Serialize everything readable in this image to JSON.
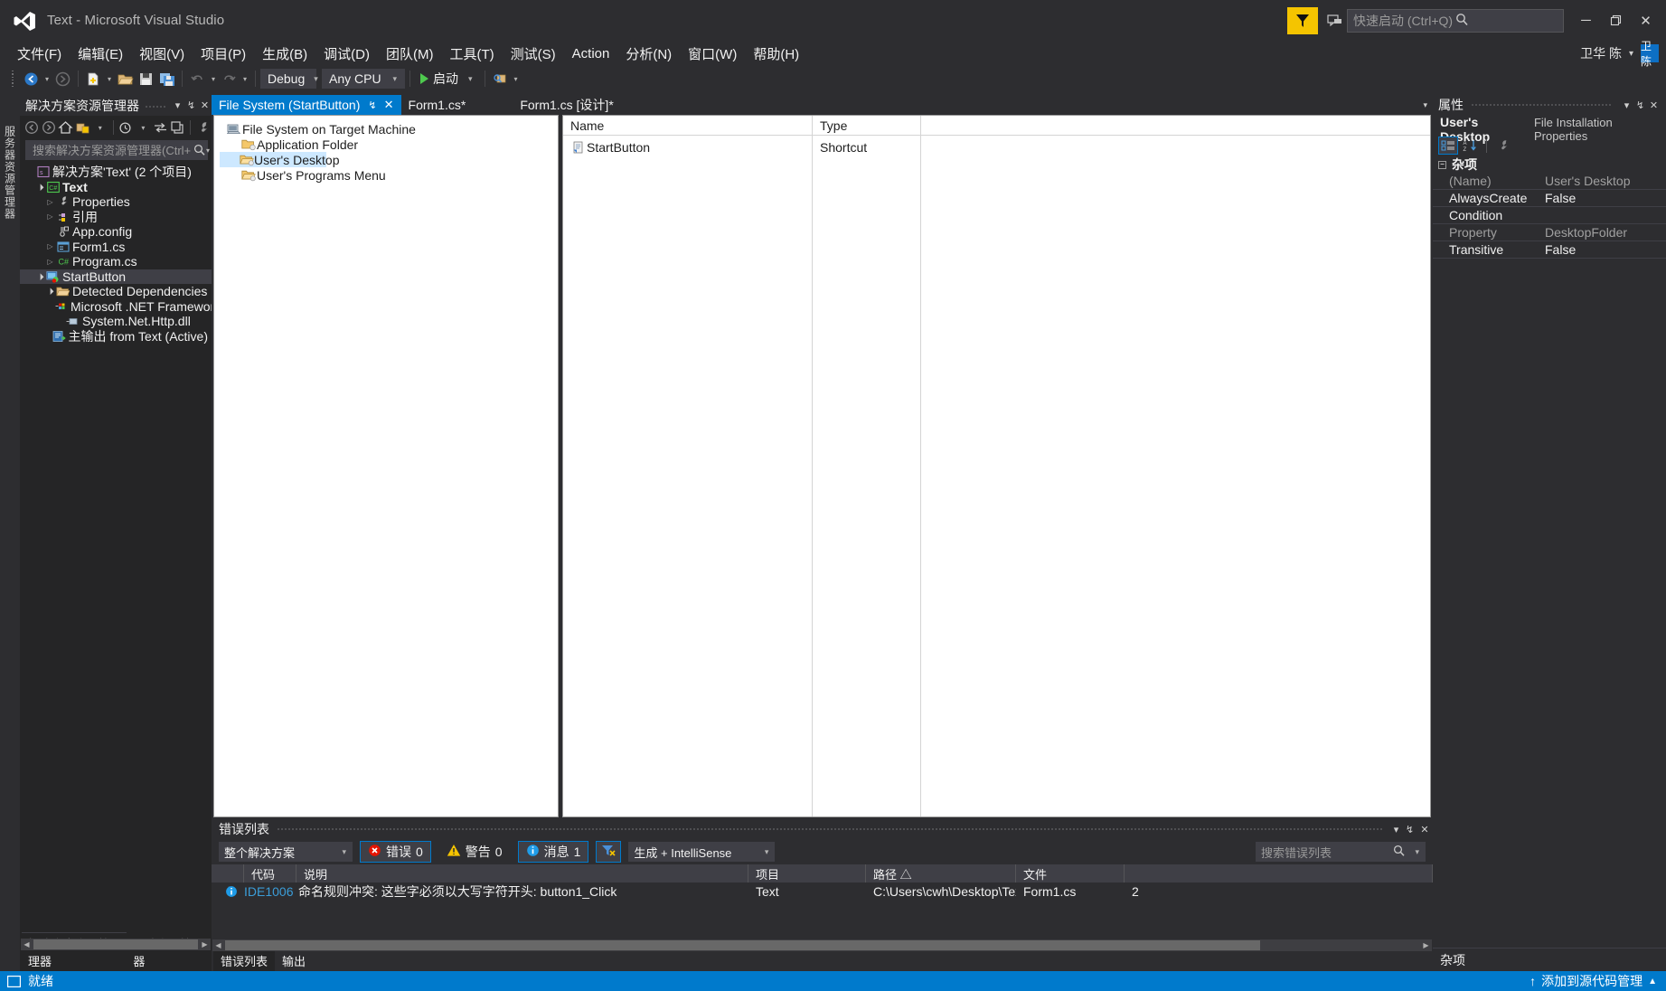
{
  "window": {
    "title": "Text - Microsoft Visual Studio",
    "logo_icon": "visual-studio-logo",
    "minimize_label": "─",
    "restore_label": "❐",
    "close_label": "✕"
  },
  "quick_launch": {
    "placeholder": "快速启动 (Ctrl+Q)",
    "value": "",
    "icon": "search-icon"
  },
  "feedback": {
    "icon": "feedback-filter-icon"
  },
  "speech": {
    "icon": "speech-bubble-icon"
  },
  "account": {
    "name": "卫华 陈",
    "badge": "卫陈",
    "caret": "▾"
  },
  "menu": {
    "items": [
      {
        "label": "文件(F)"
      },
      {
        "label": "编辑(E)"
      },
      {
        "label": "视图(V)"
      },
      {
        "label": "项目(P)"
      },
      {
        "label": "生成(B)"
      },
      {
        "label": "调试(D)"
      },
      {
        "label": "团队(M)"
      },
      {
        "label": "工具(T)"
      },
      {
        "label": "测试(S)"
      },
      {
        "label": "Action"
      },
      {
        "label": "分析(N)"
      },
      {
        "label": "窗口(W)"
      },
      {
        "label": "帮助(H)"
      }
    ]
  },
  "toolbar": {
    "back_icon": "navigate-back-icon",
    "forward_icon": "navigate-forward-icon",
    "new_item_icon": "new-item-icon",
    "open_icon": "open-file-icon",
    "save_icon": "save-icon",
    "save_all_icon": "save-all-icon",
    "undo_icon": "undo-icon",
    "redo_icon": "redo-icon",
    "config": {
      "value": "Debug",
      "caret": "▾"
    },
    "platform": {
      "value": "Any CPU",
      "caret": "▾"
    },
    "run": {
      "label": "启动",
      "caret": "▾",
      "icon": "play-icon"
    },
    "more_icon": "toolbar-overflow-icon"
  },
  "left_strip": {
    "tabs": [
      {
        "label": "服务器资源管理器"
      }
    ]
  },
  "solution_explorer": {
    "title": "解决方案资源管理器",
    "header_buttons": {
      "dropdown": "▾",
      "pin": "↯",
      "close": "✕"
    },
    "tools": [
      {
        "icon": "back-icon"
      },
      {
        "icon": "forward-icon"
      },
      {
        "icon": "home-icon"
      },
      {
        "icon": "sync-views-icon"
      },
      {
        "icon": "pending-changes-icon"
      },
      {
        "icon": "refresh-icon"
      },
      {
        "icon": "collapse-all-icon"
      },
      {
        "icon": "properties-wrench-icon"
      }
    ],
    "search": {
      "placeholder": "搜索解决方案资源管理器(Ctrl+;)",
      "value": "",
      "icon": "search-icon"
    },
    "tree": [
      {
        "label": "解决方案'Text' (2 个项目)",
        "indent": 0,
        "arrow": "",
        "icon": "solution-icon",
        "bold": false,
        "selected": false
      },
      {
        "label": "Text",
        "indent": 1,
        "arrow": "open",
        "icon": "csharp-project-icon",
        "bold": true,
        "selected": false
      },
      {
        "label": "Properties",
        "indent": 2,
        "arrow": "closed",
        "icon": "wrench-icon",
        "bold": false,
        "selected": false
      },
      {
        "label": "引用",
        "indent": 2,
        "arrow": "closed",
        "icon": "references-icon",
        "bold": false,
        "selected": false
      },
      {
        "label": "App.config",
        "indent": 2,
        "arrow": "",
        "icon": "config-file-icon",
        "bold": false,
        "selected": false
      },
      {
        "label": "Form1.cs",
        "indent": 2,
        "arrow": "closed",
        "icon": "form-icon",
        "bold": false,
        "selected": false
      },
      {
        "label": "Program.cs",
        "indent": 2,
        "arrow": "closed",
        "icon": "csharp-file-icon",
        "bold": false,
        "selected": false
      },
      {
        "label": "StartButton",
        "indent": 1,
        "arrow": "open",
        "icon": "setup-project-icon",
        "bold": false,
        "selected": true
      },
      {
        "label": "Detected Dependencies",
        "indent": 2,
        "arrow": "open",
        "icon": "folder-open-icon",
        "bold": false,
        "selected": false
      },
      {
        "label": "Microsoft .NET Framework",
        "indent": 3,
        "arrow": "",
        "icon": "dependency-icon",
        "bold": false,
        "selected": false
      },
      {
        "label": "System.Net.Http.dll",
        "indent": 3,
        "arrow": "",
        "icon": "assembly-icon",
        "bold": false,
        "selected": false
      },
      {
        "label": "主输出 from Text (Active)",
        "indent": 2,
        "arrow": "",
        "icon": "primary-output-icon",
        "bold": false,
        "selected": false
      }
    ],
    "hscroll": {
      "left_arrow": "◀",
      "right_arrow": "▶"
    },
    "bottom_tabs": [
      {
        "label": "解决方案资源管理器",
        "active": true
      },
      {
        "label": "团队资源管理器",
        "active": false
      }
    ]
  },
  "editor": {
    "tabs": [
      {
        "label": "File System (StartButton)",
        "active": true,
        "pin": "↯",
        "close": "✕"
      },
      {
        "label": "Form1.cs*",
        "active": false
      },
      {
        "label": "Form1.cs [设计]*",
        "active": false
      }
    ],
    "tabstrip_overflow": "▾",
    "fs_tree": [
      {
        "label": "File System on Target Machine",
        "indent": 0,
        "icon": "target-machine-icon",
        "selected": false
      },
      {
        "label": "Application Folder",
        "indent": 1,
        "icon": "app-folder-icon",
        "selected": false
      },
      {
        "label": "User's Desktop",
        "indent": 1,
        "icon": "desktop-folder-icon",
        "selected": true
      },
      {
        "label": "User's Programs Menu",
        "indent": 1,
        "icon": "programs-folder-icon",
        "selected": false
      }
    ],
    "list": {
      "columns": [
        {
          "label": "Name"
        },
        {
          "label": "Type"
        },
        {
          "label": ""
        }
      ],
      "rows": [
        {
          "name": "StartButton",
          "type": "Shortcut",
          "icon": "shortcut-icon"
        }
      ]
    }
  },
  "error_list": {
    "title": "错误列表",
    "header_buttons": {
      "dropdown": "▾",
      "pin": "↯",
      "close": "✕"
    },
    "scope": {
      "value": "整个解决方案",
      "caret": "▾"
    },
    "errors": {
      "label": "错误",
      "count": "0",
      "icon": "error-icon",
      "active": true
    },
    "warnings": {
      "label": "警告",
      "count": "0",
      "icon": "warning-icon",
      "active": false
    },
    "messages": {
      "label": "消息",
      "count": "1",
      "icon": "info-icon",
      "active": true
    },
    "filter": {
      "icon": "clear-filter-icon",
      "active": true
    },
    "build_filter": {
      "value": "生成 + IntelliSense",
      "caret": "▾"
    },
    "search": {
      "placeholder": "搜索错误列表",
      "value": "",
      "icon": "search-icon",
      "caret": "▾"
    },
    "columns": [
      {
        "label": ""
      },
      {
        "label": "代码"
      },
      {
        "label": "说明"
      },
      {
        "label": "项目"
      },
      {
        "label": "路径 △"
      },
      {
        "label": "文件"
      },
      {
        "label": ""
      }
    ],
    "rows": [
      {
        "icon": "info-icon",
        "code": "IDE1006",
        "description": "命名规则冲突: 这些字必须以大写字符开头: button1_Click",
        "project": "Text",
        "path": "C:\\Users\\cwh\\Desktop\\Text\\Text",
        "file": "Form1.cs",
        "line": "2"
      }
    ],
    "hscroll": {
      "left_arrow": "◀",
      "right_arrow": "▶"
    },
    "bottom_tabs": [
      {
        "label": "错误列表",
        "active": true
      },
      {
        "label": "输出",
        "active": false
      }
    ]
  },
  "properties": {
    "title": "属性",
    "header_buttons": {
      "dropdown": "▾",
      "pin": "↯",
      "close": "✕"
    },
    "object_name": "User's Desktop",
    "object_type": "File Installation Properties",
    "tools": [
      {
        "icon": "categorized-view-icon",
        "selected": true
      },
      {
        "icon": "alphabetical-sort-icon",
        "selected": false
      },
      {
        "icon": "property-pages-icon",
        "selected": false
      }
    ],
    "category": {
      "label": "杂项",
      "toggle": "−"
    },
    "rows": [
      {
        "name": "(Name)",
        "value": "User's Desktop",
        "readonly": true
      },
      {
        "name": "AlwaysCreate",
        "value": "False",
        "readonly": false
      },
      {
        "name": "Condition",
        "value": "",
        "readonly": false
      },
      {
        "name": "Property",
        "value": "DesktopFolder",
        "readonly": true
      },
      {
        "name": "Transitive",
        "value": "False",
        "readonly": false
      }
    ],
    "footer": "杂项"
  },
  "status_bar": {
    "icon": "status-ready-icon",
    "text": "就绪",
    "source_control": "添加到源代码管理",
    "up_arrow": "↑",
    "caret": "▲"
  }
}
